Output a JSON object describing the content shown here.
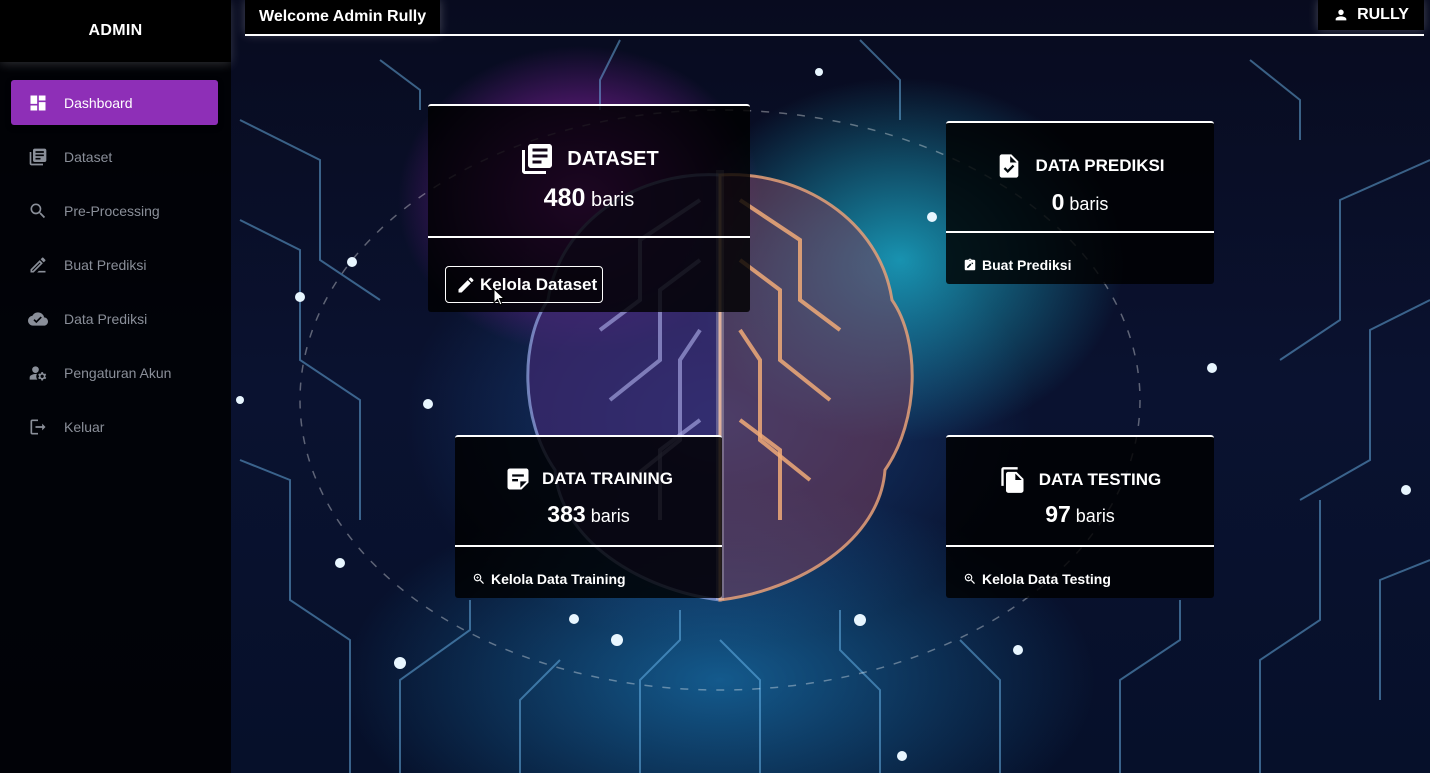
{
  "app": {
    "brand": "ADMIN",
    "welcome": "Welcome Admin Rully",
    "user_name": "RULLY"
  },
  "sidebar": {
    "items": [
      {
        "label": "Dashboard",
        "icon": "dashboard-icon",
        "active": true
      },
      {
        "label": "Dataset",
        "icon": "library-books-icon",
        "active": false
      },
      {
        "label": "Pre-Processing",
        "icon": "search-icon",
        "active": false
      },
      {
        "label": "Buat Prediksi",
        "icon": "edit-pen-icon",
        "active": false
      },
      {
        "label": "Data Prediksi",
        "icon": "cloud-done-icon",
        "active": false
      },
      {
        "label": "Pengaturan Akun",
        "icon": "manage-accounts-icon",
        "active": false
      },
      {
        "label": "Keluar",
        "icon": "logout-icon",
        "active": false
      }
    ]
  },
  "cards": {
    "dataset": {
      "title": "DATASET",
      "count": "480",
      "unit": "baris",
      "action": "Kelola Dataset",
      "icon": "library-books-icon",
      "action_icon": "edit-pen-icon"
    },
    "prediksi": {
      "title": "DATA PREDIKSI",
      "count": "0",
      "unit": "baris",
      "action": "Buat Prediksi",
      "icon": "file-check-icon",
      "action_icon": "clipboard-edit-icon"
    },
    "training": {
      "title": "DATA TRAINING",
      "count": "383",
      "unit": "baris",
      "action": "Kelola Data Training",
      "icon": "sticky-note-icon",
      "action_icon": "zoom-in-icon"
    },
    "testing": {
      "title": "DATA TESTING",
      "count": "97",
      "unit": "baris",
      "action": "Kelola Data Testing",
      "icon": "file-copy-icon",
      "action_icon": "zoom-in-icon"
    }
  },
  "colors": {
    "accent": "#8e2fb7",
    "sidebar_text": "#8a8f99",
    "card_bg": "#000000"
  }
}
